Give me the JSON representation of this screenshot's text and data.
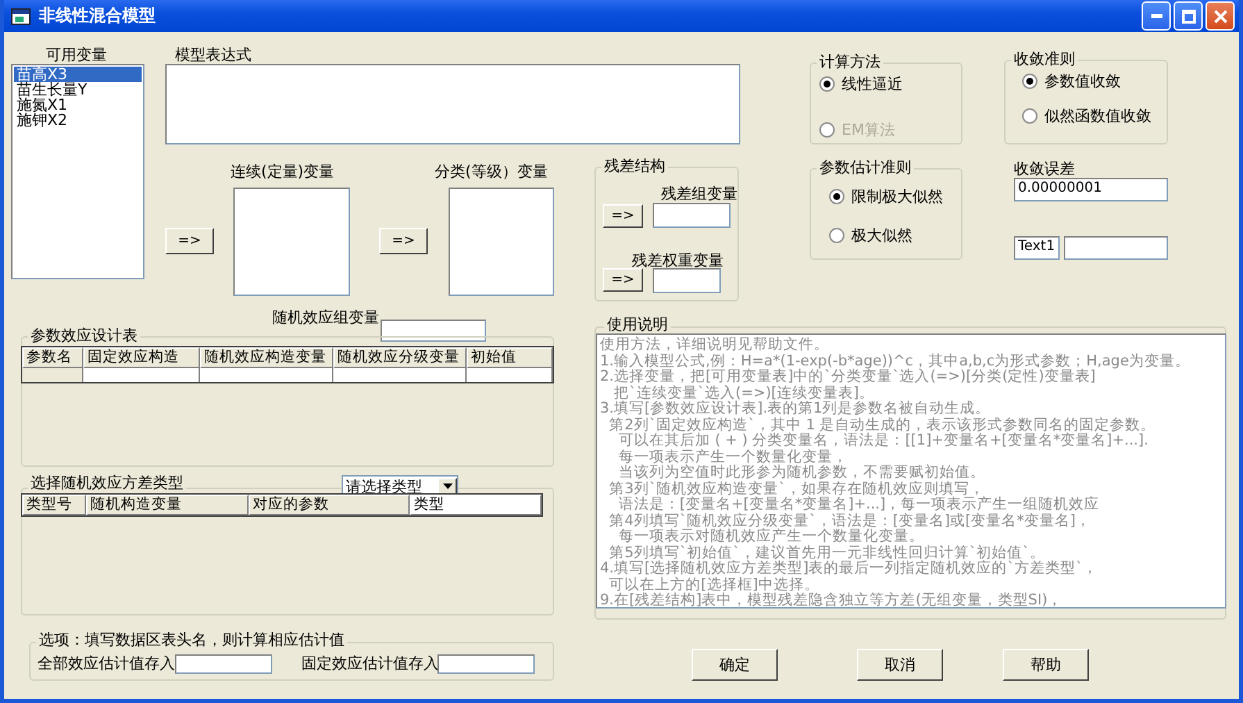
{
  "window": {
    "title": "非线性混合模型"
  },
  "variables": {
    "label": "可用变量",
    "items": [
      {
        "text": "苗高X3",
        "selected": true
      },
      {
        "text": "苗生长量Y",
        "selected": false
      },
      {
        "text": "施氮X1",
        "selected": false
      },
      {
        "text": "施钾X2",
        "selected": false
      }
    ]
  },
  "expression": {
    "label": "模型表达式"
  },
  "continuous": {
    "label": "连续(定量)变量",
    "button": "=>"
  },
  "categorical": {
    "label": "分类(等级）变量",
    "button": "=>"
  },
  "residual": {
    "title": "残差结构",
    "group_label": "残差组变量",
    "group_button": "=>",
    "weight_label": "残差权重变量",
    "weight_button": "=>"
  },
  "method": {
    "title": "计算方法",
    "options": [
      {
        "label": "线性逼近",
        "selected": true,
        "disabled": false
      },
      {
        "label": "EM算法",
        "selected": false,
        "disabled": true
      }
    ]
  },
  "convergence": {
    "title": "收敛准则",
    "options": [
      {
        "label": "参数值收敛",
        "selected": true
      },
      {
        "label": "似然函数值收敛",
        "selected": false
      }
    ]
  },
  "estimation": {
    "title": "参数估计准则",
    "options": [
      {
        "label": "限制极大似然",
        "selected": true
      },
      {
        "label": "极大似然",
        "selected": false
      }
    ]
  },
  "tolerance": {
    "label": "收敛误差",
    "value": "0.00000001"
  },
  "text1": {
    "value": "Text1"
  },
  "random_group": {
    "label": "随机效应组变量"
  },
  "design_table": {
    "title": "参数效应设计表",
    "columns": [
      "参数名",
      "固定效应构造",
      "随机效应构造变量",
      "随机效应分级变量",
      "初始值"
    ]
  },
  "variance_table": {
    "title": "选择随机效应方差类型",
    "dropdown": "请选择类型",
    "columns": [
      "类型号",
      "随机构造变量",
      "对应的参数",
      "类型"
    ]
  },
  "options": {
    "title": "选项：填写数据区表头名，则计算相应估计值",
    "all_label": "全部效应估计值存入",
    "fixed_label": "固定效应估计值存入"
  },
  "help": {
    "title": "使用说明",
    "lines": [
      "使用方法，详细说明见帮助文件。",
      "1.输入模型公式,例：H=a*(1-exp(-b*age))^c，其中a,b,c为形式参数；H,age为变量。",
      "2.选择变量，把[可用变量表]中的`分类变量`选入(=>)[分类(定性)变量表]",
      "   把`连续变量`选入(=>)[连续变量表]。",
      "3.填写[参数效应设计表].表的第1列是参数名被自动生成。",
      "  第2列`固定效应构造`，其中 1 是自动生成的，表示该形式参数同名的固定参数。",
      "    可以在其后加 ( + ) 分类变量名，语法是：[[1]+变量名+[变量名*变量名]+...].",
      "    每一项表示产生一个数量化变量，",
      "    当该列为空值时此形参为随机参数，不需要赋初始值。",
      "  第3列`随机效应构造变量`，如果存在随机效应则填写，",
      "    语法是：[变量名+[变量名*变量名]+...]，每一项表示产生一组随机效应",
      "  第4列填写`随机效应分级变量`，语法是：[变量名]或[变量名*变量名]，",
      "    每一项表示对随机效应产生一个数量化变量。",
      "  第5列填写`初始值`，建议首先用一元非线性回归计算`初始值`。",
      "4.填写[选择随机效应方差类型]表的最后一列指定随机效应的`方差类型`，",
      "  可以在上方的[选择框]中选择。",
      "9.在[残差结构]表中，模型残差隐含独立等方差(无组变量，类型SI)，"
    ]
  },
  "buttons": [
    "确定",
    "取消",
    "帮助"
  ]
}
